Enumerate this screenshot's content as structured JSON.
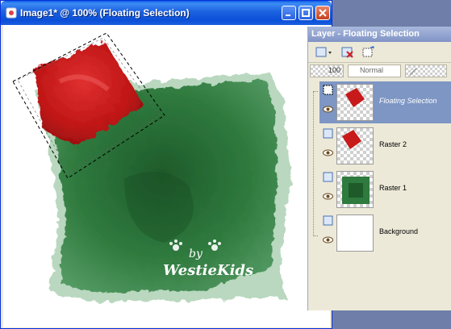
{
  "window": {
    "title": "Image1* @ 100% (Floating Selection)",
    "icons": [
      "image-doc-icon",
      "minimize-icon",
      "maximize-icon",
      "close-icon"
    ]
  },
  "canvas": {
    "watermark_line1": "by",
    "watermark_line2": "WestieKids",
    "colors": {
      "green": "#2f7a3e",
      "red": "#c81a1a",
      "white": "#ffffff"
    }
  },
  "layers_palette": {
    "title": "Layer - Floating Selection",
    "toolbar_icons": [
      "new-layer-icon",
      "delete-layer-icon",
      "layer-properties-icon"
    ],
    "opacity": "100",
    "blend_mode": "Normal",
    "layers": [
      {
        "name": "Floating Selection",
        "active": true
      },
      {
        "name": "Raster 2",
        "active": false
      },
      {
        "name": "Raster 1",
        "active": false
      },
      {
        "name": "Background",
        "active": false
      }
    ]
  }
}
